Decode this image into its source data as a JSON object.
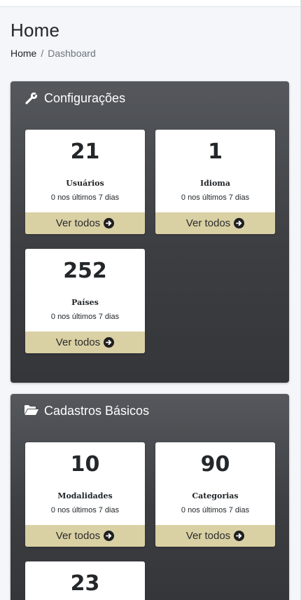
{
  "page": {
    "title": "Home",
    "breadcrumb": {
      "home": "Home",
      "separator": "/",
      "current": "Dashboard"
    }
  },
  "sections": [
    {
      "title": "Configurações",
      "icon": "wrench-icon",
      "cards": [
        {
          "count": "21",
          "label": "Usuários",
          "sub": "0 nos últimos 7 dias",
          "link": "Ver todos"
        },
        {
          "count": "1",
          "label": "Idioma",
          "sub": "0 nos últimos 7 dias",
          "link": "Ver todos"
        },
        {
          "count": "252",
          "label": "Países",
          "sub": "0 nos últimos 7 dias",
          "link": "Ver todos"
        }
      ]
    },
    {
      "title": "Cadastros Básicos",
      "icon": "folder-open-icon",
      "cards": [
        {
          "count": "10",
          "label": "Modalidades",
          "sub": "0 nos últimos 7 dias",
          "link": "Ver todos"
        },
        {
          "count": "90",
          "label": "Categorias",
          "sub": "0 nos últimos 7 dias",
          "link": "Ver todos"
        },
        {
          "count": "23"
        }
      ]
    }
  ],
  "colors": {
    "section_bg": "#3c3e42",
    "card_footer": "#d9d0a4",
    "page_bg": "#f4f6f9"
  }
}
